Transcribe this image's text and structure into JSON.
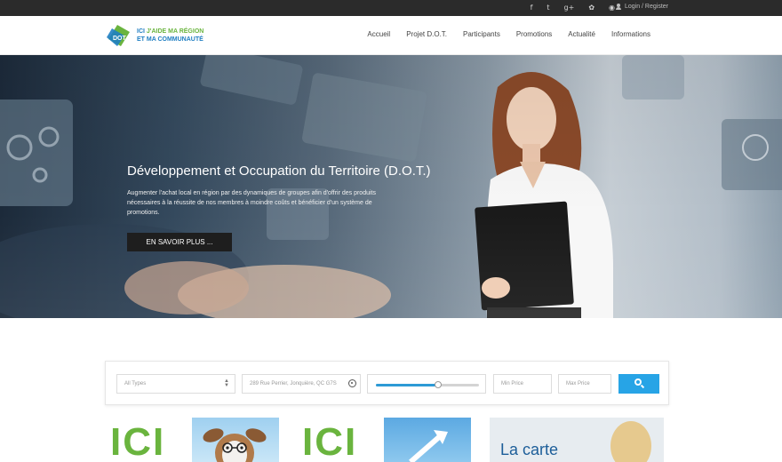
{
  "topbar": {
    "social": [
      {
        "name": "facebook-icon",
        "glyph": "f"
      },
      {
        "name": "twitter-icon",
        "glyph": "t"
      },
      {
        "name": "google-plus-icon",
        "glyph": "g+"
      },
      {
        "name": "flickr-icon",
        "glyph": "✿"
      },
      {
        "name": "rss-icon",
        "glyph": "◉"
      }
    ],
    "login_label": "Login / Register"
  },
  "header": {
    "logo": {
      "line1_prefix": "ICI",
      "line1_suffix": "J'AIDE MA RÉGION",
      "line2": "ET MA COMMUNAUTÉ",
      "badge": "DOT"
    },
    "nav": [
      "Accueil",
      "Projet D.O.T.",
      "Participants",
      "Promotions",
      "Actualité",
      "Informations"
    ]
  },
  "hero": {
    "title": "Développement et Occupation du Territoire (D.O.T.)",
    "description": "Augmenter l'achat local en région par des dynamiques de groupes afin d'offrir des produits nécessaires à la réussite de nos membres à moindre coûts et bénéficier d'un système de promotions.",
    "button": "EN SAVOIR PLUS ..."
  },
  "filter": {
    "type_placeholder": "All Types",
    "address_value": "289 Rue Perrier, Jonquière, QC G7S",
    "range_fraction": 0.6,
    "min_price_placeholder": "Min Price",
    "max_price_placeholder": "Max Price"
  },
  "cards": {
    "card1_text": "ICI",
    "card2_text": "ICI",
    "card3_text": "La carte"
  },
  "colors": {
    "accent": "#27a4e6",
    "brand_green": "#6ab43e",
    "brand_blue": "#1f7ec2",
    "topbar": "#2b2b2b"
  }
}
